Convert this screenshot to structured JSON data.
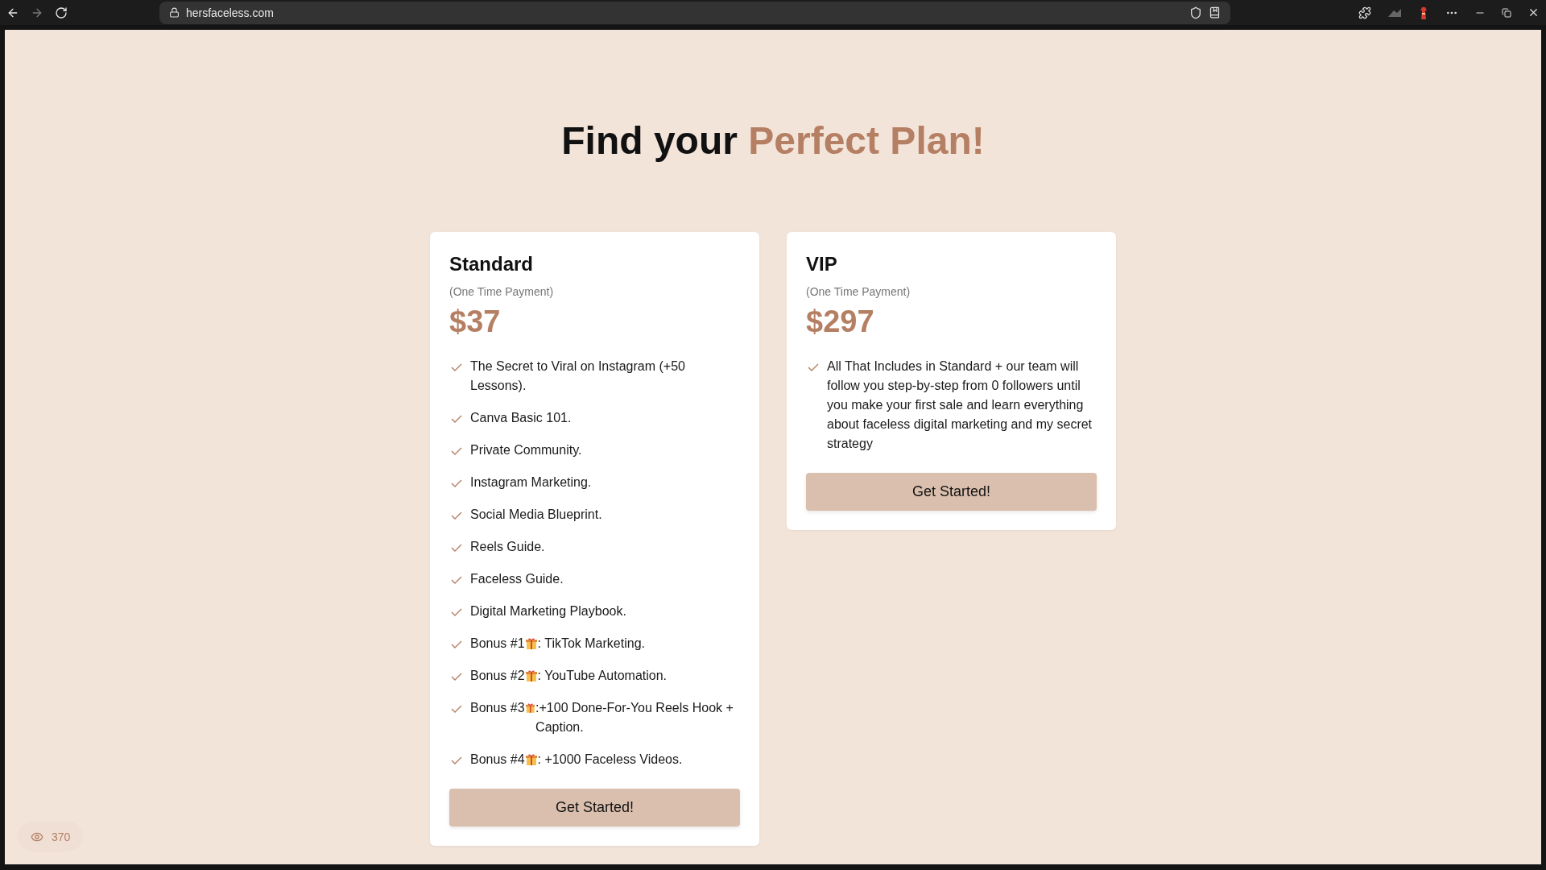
{
  "browser": {
    "nav": [
      {
        "kind": "back",
        "disabled": false
      },
      {
        "kind": "forward",
        "disabled": true
      },
      {
        "kind": "reload",
        "disabled": false
      }
    ],
    "url": "hersfaceless.com"
  },
  "heading": {
    "lead": "Find your",
    "accent": "Perfect Plan!"
  },
  "plans": [
    {
      "name": "Standard",
      "note": "(One Time Payment)",
      "price": "$37",
      "features": [
        {
          "text": "The Secret to Viral on Instagram (+50 Lessons)."
        },
        {
          "text": "Canva Basic 101."
        },
        {
          "text": "Private Community."
        },
        {
          "text": "Instagram Marketing."
        },
        {
          "text": "Social Media Blueprint."
        },
        {
          "text": "Reels Guide."
        },
        {
          "text": "Faceless Guide."
        },
        {
          "text": "Digital Marketing Playbook."
        },
        {
          "text": "Bonus #1",
          "after": ": TikTok Marketing."
        },
        {
          "text": "Bonus #2",
          "after": ": YouTube Automation."
        },
        {
          "text": "Bonus #3",
          "after": ":+100 Done-For-You Reels Hook + Caption."
        },
        {
          "text": "Bonus #4",
          "after": ": +1000 Faceless Videos."
        }
      ],
      "button": "Get Started!"
    },
    {
      "name": "VIP",
      "note": "(One Time Payment)",
      "price": "$297",
      "features": [
        {
          "text": "All That Includes in Standard + our team will follow you step-by-step from 0 followers until you make your first sale and learn everything about faceless digital marketing and my secret strategy"
        }
      ],
      "button": "Get Started!"
    }
  ],
  "views": "370"
}
